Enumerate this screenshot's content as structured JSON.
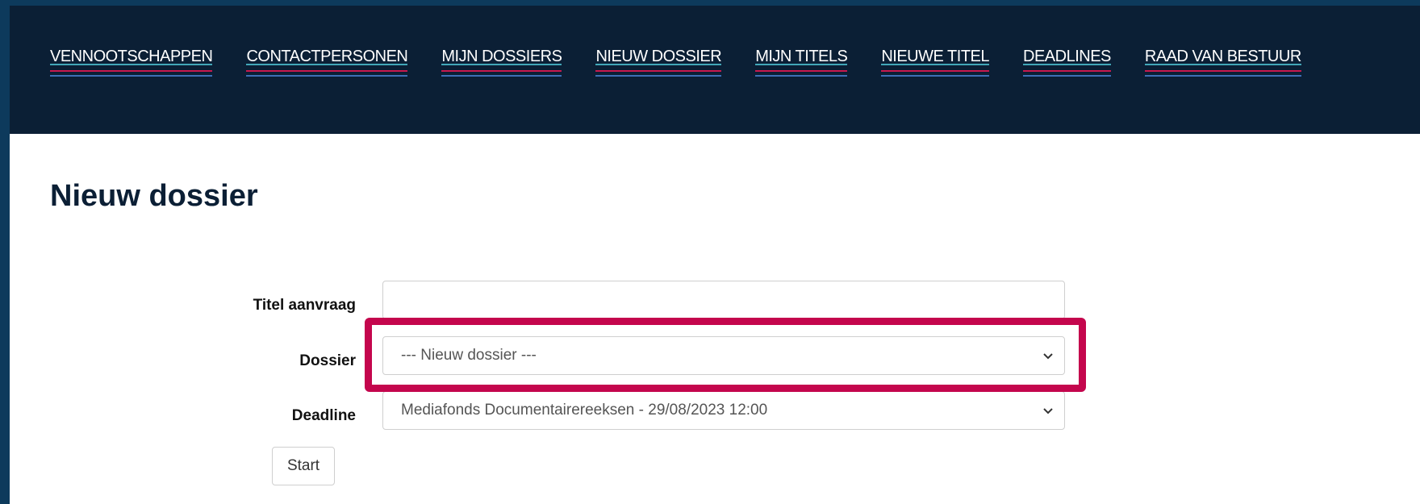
{
  "nav": {
    "items": [
      {
        "label": "VENNOOTSCHAPPEN"
      },
      {
        "label": "CONTACTPERSONEN"
      },
      {
        "label": "MIJN DOSSIERS"
      },
      {
        "label": "NIEUW DOSSIER"
      },
      {
        "label": "MIJN TITELS"
      },
      {
        "label": "NIEUWE TITEL"
      },
      {
        "label": "DEADLINES"
      },
      {
        "label": "RAAD VAN BESTUUR"
      }
    ],
    "colors": {
      "background": "#0b1f35",
      "underline_teal": "#41a7b8",
      "underline_red": "#c8194f",
      "underline_blue": "#3d6fb6"
    }
  },
  "page": {
    "title": "Nieuw dossier"
  },
  "form": {
    "titel": {
      "label": "Titel aanvraag",
      "value": ""
    },
    "dossier": {
      "label": "Dossier",
      "selected": "--- Nieuw dossier ---"
    },
    "deadline": {
      "label": "Deadline",
      "selected": "Mediafonds Documentairereeksen - 29/08/2023 12:00"
    },
    "start_label": "Start"
  },
  "highlight": {
    "color": "#c4064d",
    "target": "dossier-select"
  }
}
